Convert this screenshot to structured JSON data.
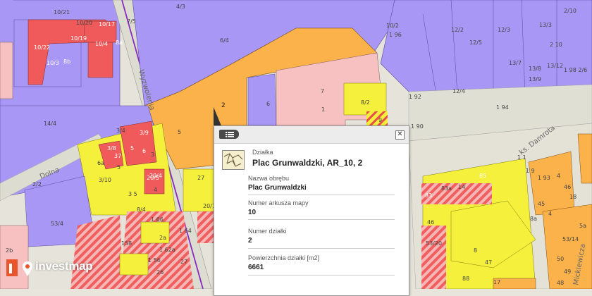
{
  "map": {
    "streets": {
      "west": "Dolna",
      "central": "Wyzwolenia",
      "east": "ks. Damrota",
      "southeast": "Mickiewicza"
    },
    "parcel_labels": [
      "10/21",
      "10/20",
      "10/17",
      "10/19",
      "10/22",
      "10/4",
      "8a",
      "10/3",
      "8b",
      "7/5",
      "4/3",
      "6/4",
      "10/2",
      "1 96",
      "12/2",
      "12/3",
      "13/3",
      "2/10",
      "12/5",
      "2 10",
      "13/7",
      "13/12",
      "1 98 2/6",
      "13/8",
      "1 92",
      "13/9",
      "12/4",
      "1 94",
      "6",
      "7",
      "1",
      "8/2",
      "9",
      "2",
      "1 90",
      "14/4",
      "2/2",
      "3/4",
      "3/9",
      "5",
      "3/8",
      "37",
      "6",
      "5",
      "3",
      "5",
      "6a",
      "3/10",
      "3 5",
      "8/4",
      "20/5",
      "20/4",
      "4",
      "27",
      "20/1",
      "1 1",
      "1 9",
      "1 93",
      "4",
      "46",
      "18",
      "45",
      "4",
      "8a",
      "5a",
      "53/14",
      "50",
      "49",
      "48",
      "47",
      "46",
      "53/20",
      "8",
      "83",
      "83a",
      "85",
      "14",
      "88",
      "17",
      "53/4",
      "158",
      "1 56",
      "1 62a",
      "26",
      "27",
      "1 64",
      "1 66",
      "2a",
      "2b",
      "2",
      "14/7"
    ],
    "colors": {
      "commercial": "#a695fb",
      "multifamily": "#f5f03c",
      "singlefamily": "#f45d5d",
      "pending": "#fcb24b",
      "residential_pink": "#f7c1c2",
      "service": "#ffcc99"
    }
  },
  "popup": {
    "menu_icon": "list-icon",
    "close_label": "✕",
    "layer_name": "Działka",
    "title": "Plac Grunwaldzki, AR_10, 2",
    "fields": [
      {
        "key": "Nazwa obrębu",
        "value": "Plac Grunwaldzki"
      },
      {
        "key": "Numer arkusza mapy",
        "value": "10"
      },
      {
        "key": "Numer działki",
        "value": "2"
      },
      {
        "key": "Powierzchnia działki [m2]",
        "value": "6661"
      }
    ]
  },
  "logo": {
    "text": "investmap"
  }
}
